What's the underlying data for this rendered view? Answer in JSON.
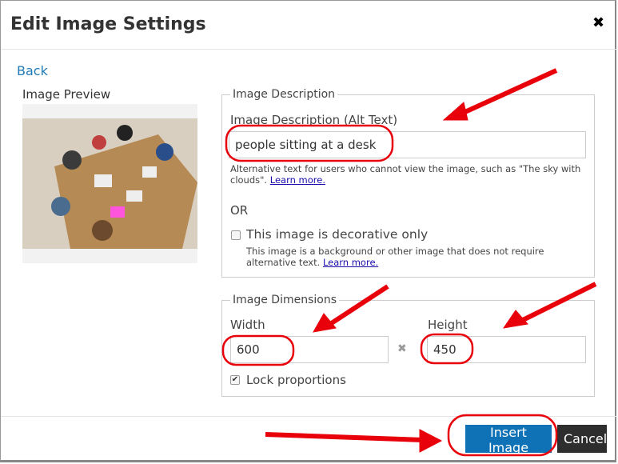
{
  "dialog": {
    "title": "Edit Image Settings",
    "close_icon": "close-icon"
  },
  "back_link": "Back",
  "preview": {
    "label": "Image Preview"
  },
  "description": {
    "legend": "Image Description",
    "alt_label": "Image Description (Alt Text)",
    "alt_value": "people sitting at a desk",
    "help": "Alternative text for users who cannot view the image, such as \"The sky with clouds\".",
    "help_link": "Learn more.",
    "or": "OR",
    "decorative_label": "This image is decorative only",
    "decorative_checked": false,
    "decorative_help": "This image is a background or other image that does not require alternative text.",
    "decorative_link": "Learn more."
  },
  "dimensions": {
    "legend": "Image Dimensions",
    "width_label": "Width",
    "width_value": "600",
    "height_label": "Height",
    "height_value": "450",
    "times_icon": "times-icon",
    "lock_label": "Lock proportions",
    "lock_checked": true
  },
  "footer": {
    "insert": "Insert Image",
    "cancel": "Cancel"
  },
  "colors": {
    "primary": "#0f72b6",
    "annotation": "#e8000b",
    "link": "#1f7ab5"
  }
}
